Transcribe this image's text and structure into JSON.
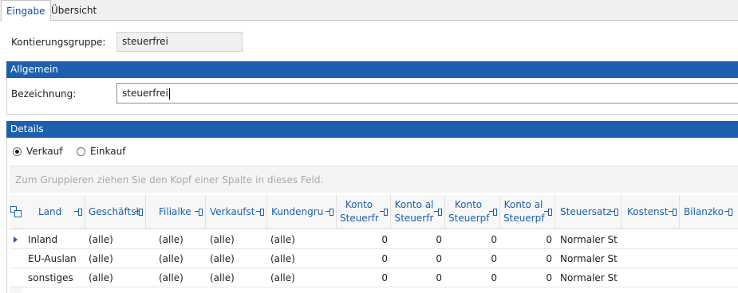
{
  "tabs": [
    {
      "label": "Eingabe",
      "active": true
    },
    {
      "label": "Übersicht",
      "active": false
    }
  ],
  "kontierungsgruppe": {
    "label": "Kontierungsgruppe:",
    "value": "steuerfrei"
  },
  "allgemein": {
    "title": "Allgemein",
    "bezeichnung_label": "Bezeichnung:",
    "bezeichnung_value": "steuerfrei"
  },
  "details": {
    "title": "Details",
    "radios": [
      {
        "label": "Verkauf",
        "selected": true
      },
      {
        "label": "Einkauf",
        "selected": false
      }
    ],
    "group_hint": "Zum Gruppieren ziehen Sie den Kopf einer Spalte in dieses Feld."
  },
  "grid": {
    "columns": [
      {
        "line1": "Land",
        "line2": ""
      },
      {
        "line1": "Geschäftsb",
        "line2": ""
      },
      {
        "line1": "Filialke",
        "line2": ""
      },
      {
        "line1": "Verkaufst",
        "line2": ""
      },
      {
        "line1": "Kundengru",
        "line2": ""
      },
      {
        "line1": "Konto",
        "line2": "Steuerfr"
      },
      {
        "line1": "Konto al",
        "line2": "Steuerfr"
      },
      {
        "line1": "Konto",
        "line2": "Steuerpf"
      },
      {
        "line1": "Konto al",
        "line2": "Steuerpf"
      },
      {
        "line1": "Steuersatz",
        "line2": ""
      },
      {
        "line1": "Kostenst",
        "line2": ""
      },
      {
        "line1": "Bilanzko",
        "line2": ""
      }
    ],
    "rows": [
      {
        "active": true,
        "cells": [
          "Inland",
          "(alle)",
          "(alle)",
          "(alle)",
          "(alle)",
          "0",
          "0",
          "0",
          "0",
          "Normaler St",
          "",
          ""
        ]
      },
      {
        "active": false,
        "cells": [
          "EU-Auslan",
          "(alle)",
          "(alle)",
          "(alle)",
          "(alle)",
          "0",
          "0",
          "0",
          "0",
          "Normaler St",
          "",
          ""
        ]
      },
      {
        "active": false,
        "cells": [
          "sonstiges",
          "(alle)",
          "(alle)",
          "(alle)",
          "(alle)",
          "0",
          "0",
          "0",
          "0",
          "Normaler St",
          "",
          ""
        ]
      }
    ]
  },
  "colors": {
    "accent": "#1c5fad",
    "section_bg": "#1c5fad",
    "hint_text": "#a9a9a9"
  }
}
